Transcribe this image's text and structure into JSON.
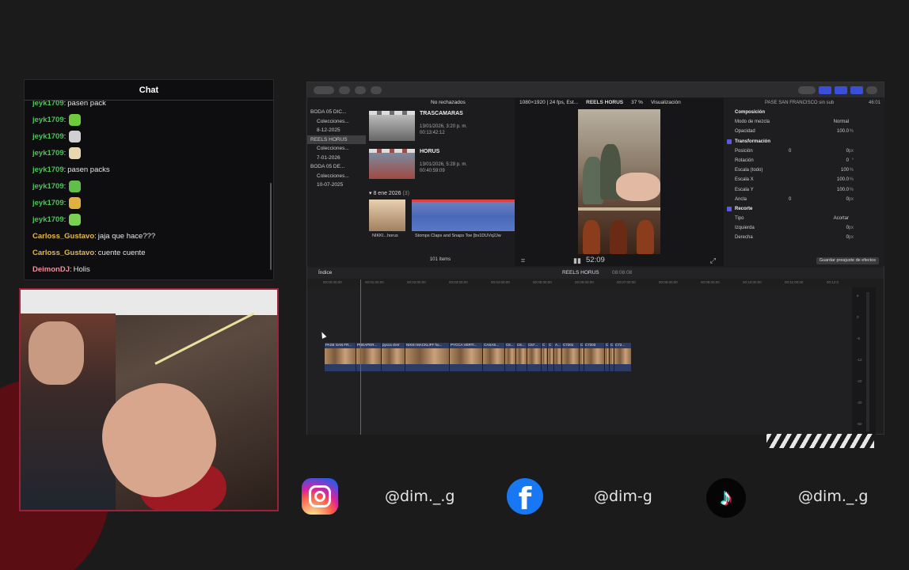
{
  "chat": {
    "title": "Chat",
    "messages": [
      {
        "user": "jeyk1709",
        "text": "pasen pack",
        "color": "#4fc35a",
        "emote": ""
      },
      {
        "user": "jeyk1709",
        "text": "",
        "color": "#4fc35a",
        "emote": "#6ecb3a"
      },
      {
        "user": "jeyk1709",
        "text": "",
        "color": "#4fc35a",
        "emote": "#d0d0d0"
      },
      {
        "user": "jeyk1709",
        "text": "",
        "color": "#4fc35a",
        "emote": "#e8d8b0"
      },
      {
        "user": "jeyk1709",
        "text": "pasen packs",
        "color": "#4fc35a",
        "emote": ""
      },
      {
        "user": "jeyk1709",
        "text": "",
        "color": "#4fc35a",
        "emote": "#5fbf4a"
      },
      {
        "user": "jeyk1709",
        "text": "",
        "color": "#4fc35a",
        "emote": "#e0b040"
      },
      {
        "user": "jeyk1709",
        "text": "",
        "color": "#4fc35a",
        "emote": "#7ad050"
      },
      {
        "user": "Carloss_Gustavo",
        "text": "jaja que hace???",
        "color": "#e6b84a",
        "emote": ""
      },
      {
        "user": "Carloss_Gustavo",
        "text": "cuente cuente",
        "color": "#e6b84a",
        "emote": ""
      },
      {
        "user": "DeimonDJ",
        "text": "Holis",
        "color": "#f08fa0",
        "emote": ""
      }
    ]
  },
  "fcp": {
    "browser_filter": "No rechazados",
    "libraries": [
      {
        "label": "BODA 05 DIC...",
        "level": 0,
        "selected": false
      },
      {
        "label": "Colecciones...",
        "level": 1,
        "selected": false
      },
      {
        "label": "8-12-2025",
        "level": 1,
        "selected": false
      },
      {
        "label": "REELS HORUS",
        "level": 0,
        "selected": true
      },
      {
        "label": "Colecciones...",
        "level": 1,
        "selected": false
      },
      {
        "label": "7-01-2026",
        "level": 1,
        "selected": false
      },
      {
        "label": "BODA 05 DE...",
        "level": 0,
        "selected": false
      },
      {
        "label": "Colecciones...",
        "level": 1,
        "selected": false
      },
      {
        "label": "10-07-2025",
        "level": 1,
        "selected": false
      }
    ],
    "clips": [
      {
        "name": "TRASCAMARAS",
        "date": "13/01/2026, 3:20 p. m.",
        "duration": "00:13:42:12"
      },
      {
        "name": "HORUS",
        "date": "13/01/2026, 5:28 p. m.",
        "duration": "00:40:59:09"
      }
    ],
    "date_group": "8 ene 2026",
    "date_group_count": "(3)",
    "thumb_labels": [
      "NIKKI...horus",
      "Stomps Claps and Snaps Toe [bv1DUVq2Jw"
    ],
    "items_count": "101 ítems",
    "viewer": {
      "format": "1080×1920 | 24 fps, Est...",
      "project": "REELS HORUS",
      "zoom": "37 %",
      "view_menu": "Visualización",
      "timecode": "52:09"
    },
    "inspector": {
      "title": "PASE SAN FRANCISCO sin sub",
      "time": "46:01",
      "sections": {
        "composition": "Composición",
        "blend_mode_label": "Modo de mezcla",
        "blend_mode_value": "Normal",
        "opacity_label": "Opacidad",
        "opacity_value": "100.0",
        "transform": "Transformación",
        "position_label": "Posición",
        "position_x": "0",
        "position_y": "0",
        "rotation_label": "Rotación",
        "rotation_value": "0",
        "scale_all_label": "Escala (todo)",
        "scale_all_value": "100",
        "scale_x_label": "Escala X",
        "scale_x_value": "100.0",
        "scale_y_label": "Escala Y",
        "scale_y_value": "100.0",
        "anchor_label": "Ancla",
        "anchor_x": "0",
        "anchor_y": "0",
        "crop": "Recorte",
        "crop_type_label": "Tipo",
        "crop_type_value": "Acortar",
        "left_label": "Izquierda",
        "left_value": "0",
        "right_label": "Derecha",
        "right_value": "0",
        "save_preset": "Guardar preajuste de efectos"
      }
    },
    "timeline": {
      "index": "Índice",
      "project": "REELS HORUS",
      "duration": "08:08:08",
      "ruler": [
        "00:00:00:00",
        "00:01:00:00",
        "00:02:00:00",
        "00:03:00:00",
        "00:04:00:00",
        "00:05:00:00",
        "00:06:00:00",
        "00:07:00:00",
        "00:08:00:00",
        "00:09:00:00",
        "00:10:00:00",
        "00:11:00:00",
        "00:12:0"
      ],
      "clips": [
        "PASE SAN FR...",
        "PREAPER...",
        "pycca clerr",
        "NIKKI MACKLIFF ho...",
        "PYCCA VERTI...",
        "CASAS...",
        "C6...",
        "C6...",
        "C67...",
        "C",
        "C",
        "A...",
        "C7201",
        "C",
        "C7203",
        "C",
        "C",
        "C72..."
      ],
      "meter_labels": [
        "6",
        "0",
        "-6",
        "-12",
        "-20",
        "-30",
        "-50"
      ]
    }
  },
  "socials": {
    "instagram_handle": "@dim._.g",
    "facebook_handle": "@dim-g",
    "tiktok_handle": "@dim._.g",
    "instagram_color": "#d6249f",
    "facebook_color": "#1877f2"
  }
}
